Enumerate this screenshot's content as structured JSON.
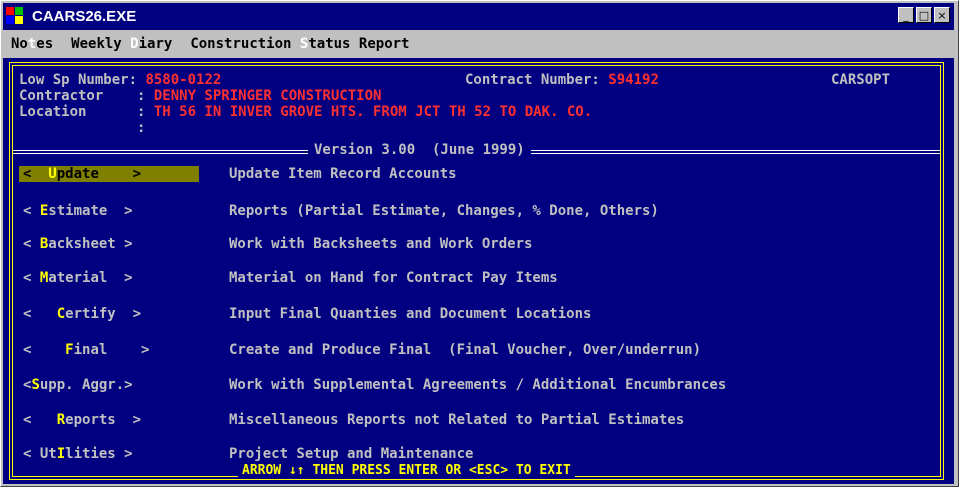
{
  "window": {
    "title": "CAARS26.EXE"
  },
  "menu": [
    {
      "pre": "No",
      "hot": "t",
      "post": "es"
    },
    {
      "pre": "Weekly ",
      "hot": "D",
      "post": "iary"
    },
    {
      "pre": "Construction ",
      "hot": "S",
      "post": "tatus Report"
    }
  ],
  "header": {
    "low_sp_label": "Low Sp Number: ",
    "low_sp_value": "8580-0122",
    "contract_label": "Contract Number: ",
    "contract_value": "S94192",
    "program": "CARSOPT",
    "contractor_label": "Contractor    : ",
    "contractor_value": "DENNY SPRINGER CONSTRUCTION",
    "location_label": "Location      : ",
    "location_value": "TH 56 IN INVER GROVE HTS. FROM JCT TH 52 TO DAK. CO.",
    "blank_colon": "              :"
  },
  "version": "Version 3.00  (June 1999)",
  "options": [
    {
      "pre": "<  ",
      "hot": "U",
      "post": "pdate    >",
      "desc": "Update Item Record Accounts",
      "selected": true
    },
    {
      "pre": "< ",
      "hot": "E",
      "post": "stimate  >",
      "desc": "Reports (Partial Estimate, Changes, % Done, Others)"
    },
    {
      "pre": "< ",
      "hot": "B",
      "post": "acksheet >",
      "desc": "Work with Backsheets and Work Orders"
    },
    {
      "pre": "< ",
      "hot": "M",
      "post": "aterial  >",
      "desc": "Material on Hand for Contract Pay Items"
    },
    {
      "pre": "<   ",
      "hot": "C",
      "post": "ertify  >",
      "desc": "Input Final Quanties and Document Locations"
    },
    {
      "pre": "<    ",
      "hot": "F",
      "post": "inal    >",
      "desc": "Create and Produce Final  (Final Voucher, Over/underrun)"
    },
    {
      "pre": "<",
      "hot": "S",
      "post": "upp. Aggr.>",
      "desc": "Work with Supplemental Agreements / Additional Encumbrances"
    },
    {
      "pre": "<   ",
      "hot": "R",
      "post": "eports  >",
      "desc": "Miscellaneous Reports not Related to Partial Estimates"
    },
    {
      "pre": "< Ut",
      "hot": "I",
      "post": "lities >",
      "desc": "Project Setup and Maintenance"
    }
  ],
  "footer": "ARROW ↓↑ THEN PRESS ENTER OR <ESC> TO EXIT"
}
